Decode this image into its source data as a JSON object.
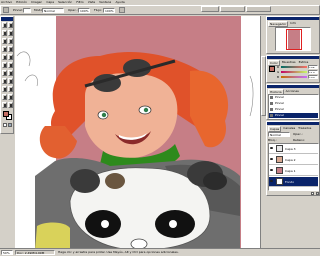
{
  "menu_bar": {
    "items": [
      "Archivo",
      "Edición",
      "Imagen",
      "Capa",
      "Selección",
      "Filtro",
      "Vista",
      "Ventana",
      "Ayuda"
    ]
  },
  "options_bar": {
    "brush_label": "Pincel:",
    "mode_label": "Modo:",
    "mode_value": "Normal",
    "opacity_label": "Opac.:",
    "opacity_value": "100%",
    "flow_label": "Flujo:",
    "flow_value": "100%",
    "tab_brushes": "Pinceles",
    "tab_tools": "Ajustes herr.",
    "tab_layer_comps": "Comp. capas"
  },
  "navigator": {
    "tabs": [
      "Navegador",
      "Info"
    ]
  },
  "color_panel": {
    "tabs": [
      "Color",
      "Muestras",
      "Estilos"
    ],
    "channels": [
      "R",
      "G",
      "B"
    ],
    "values": [
      "195",
      "110",
      "100"
    ]
  },
  "history_panel": {
    "tabs": [
      "Historia",
      "Acciones"
    ],
    "items": [
      "Pincel",
      "Pincel",
      "Pincel",
      "Pincel"
    ]
  },
  "layers_panel": {
    "tabs": [
      "Capas",
      "Canales",
      "Trazados"
    ],
    "blend_mode": "Normal",
    "opacity_label": "Opac.:",
    "lock_label": "Bloq.:",
    "fill_label": "Relleno:",
    "layers": [
      {
        "name": "Capa 3"
      },
      {
        "name": "Capa 2"
      },
      {
        "name": "Capa 1"
      },
      {
        "name": "Fondo"
      }
    ]
  },
  "status_bar": {
    "zoom": "50%",
    "doc_info": "Doc: 2,49M/4,99M",
    "hint": "Haga clic y arrastre para pintar. Use Mayús, Alt y Ctrl para opciones adicionales."
  },
  "colors": {
    "foreground": "#c46e64",
    "background": "#ffffff",
    "canvas_bg": "#c67e86",
    "hair": "#e0522a",
    "scarf": "#2e8a1c"
  }
}
